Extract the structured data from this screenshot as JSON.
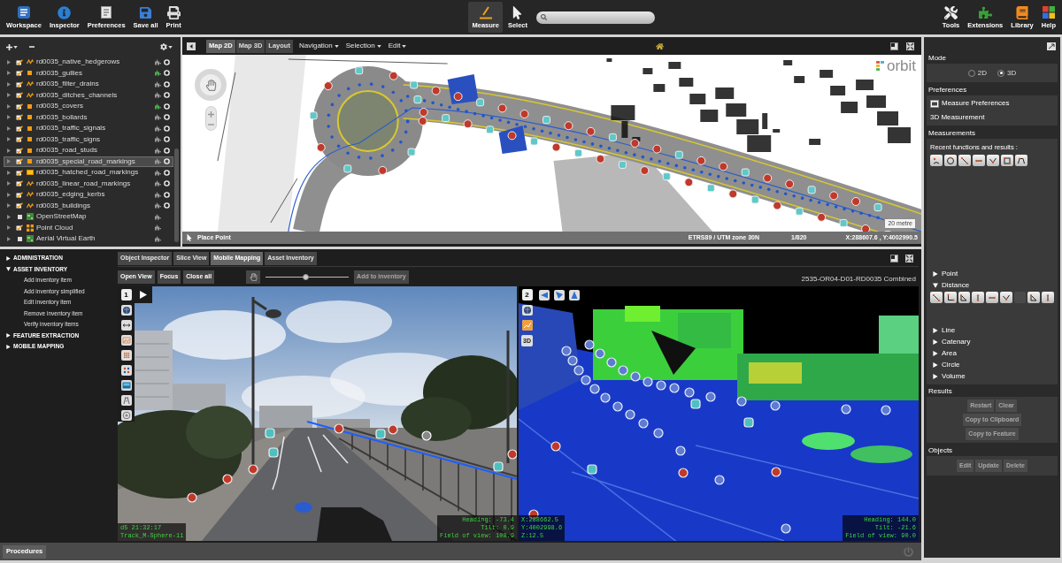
{
  "toolbar": {
    "left": [
      {
        "label": "Workspace"
      },
      {
        "label": "Inspector"
      },
      {
        "label": "Preferences"
      },
      {
        "label": "Save all"
      },
      {
        "label": "Print"
      }
    ],
    "center": [
      {
        "label": "Measure",
        "selected": true
      },
      {
        "label": "Select",
        "selected": false
      }
    ],
    "right": [
      {
        "label": "Tools"
      },
      {
        "label": "Extensions"
      },
      {
        "label": "Library"
      },
      {
        "label": "Help"
      }
    ]
  },
  "layers": {
    "items": [
      {
        "name": "rd0035_native_hedgerows",
        "kind": "line",
        "checked": true,
        "selected": false,
        "extension_active": false,
        "ring": true
      },
      {
        "name": "rd0035_gullies",
        "kind": "point",
        "checked": true,
        "selected": false,
        "extension_active": true,
        "ring": true
      },
      {
        "name": "rd0035_filter_drains",
        "kind": "line",
        "checked": true,
        "selected": false,
        "extension_active": false,
        "ring": true
      },
      {
        "name": "rd0035_ditches_channels",
        "kind": "line",
        "checked": true,
        "selected": false,
        "extension_active": false,
        "ring": true
      },
      {
        "name": "rd0035_covers",
        "kind": "point",
        "checked": true,
        "selected": false,
        "extension_active": true,
        "ring": true
      },
      {
        "name": "rd0035_bollards",
        "kind": "point",
        "checked": true,
        "selected": false,
        "extension_active": false,
        "ring": true
      },
      {
        "name": "rd0035_traffic_signals",
        "kind": "point",
        "checked": true,
        "selected": false,
        "extension_active": false,
        "ring": true
      },
      {
        "name": "rd0035_traffic_signs",
        "kind": "point",
        "checked": true,
        "selected": false,
        "extension_active": false,
        "ring": true
      },
      {
        "name": "rd0035_road_studs",
        "kind": "point",
        "checked": true,
        "selected": false,
        "extension_active": false,
        "ring": true
      },
      {
        "name": "rd0035_special_road_markings",
        "kind": "point",
        "checked": true,
        "selected": true,
        "extension_active": false,
        "ring": true
      },
      {
        "name": "rd0035_hatched_road_markings",
        "kind": "area",
        "checked": true,
        "selected": false,
        "extension_active": false,
        "ring": true
      },
      {
        "name": "rd0035_linear_road_markings",
        "kind": "line",
        "checked": true,
        "selected": false,
        "extension_active": false,
        "ring": true
      },
      {
        "name": "rd0035_edging_kerbs",
        "kind": "line",
        "checked": true,
        "selected": false,
        "extension_active": false,
        "ring": true
      },
      {
        "name": "rd0035_buildings",
        "kind": "line",
        "checked": true,
        "selected": false,
        "extension_active": false,
        "ring": true
      },
      {
        "name": "OpenStreetMap",
        "kind": "map",
        "checked": false,
        "selected": false,
        "extension_active": false,
        "ring": false
      },
      {
        "name": "Point Cloud",
        "kind": "cloud",
        "checked": true,
        "selected": false,
        "extension_active": false,
        "ring": false
      },
      {
        "name": "Aerial Virtual Earth",
        "kind": "map",
        "checked": false,
        "selected": false,
        "extension_active": false,
        "ring": false
      }
    ]
  },
  "map": {
    "tabs": [
      {
        "label": "Map 2D",
        "selected": true
      },
      {
        "label": "Map 3D",
        "selected": false
      },
      {
        "label": "Layout",
        "selected": false
      }
    ],
    "menus": [
      {
        "label": "Navigation"
      },
      {
        "label": "Selection"
      },
      {
        "label": "Edit"
      }
    ],
    "logo": "orbit",
    "scale": "20 metre",
    "status_bar": {
      "tool": "Place Point",
      "crs": "ETRS89 / UTM zone 30N",
      "ratio": "1/820",
      "coordinates": "X:288607.6 , Y:4002990.5"
    }
  },
  "procedures": {
    "sections": [
      {
        "label": "ADMINISTRATION",
        "expanded": false
      },
      {
        "label": "ASSET INVENTORY",
        "expanded": true,
        "children": [
          {
            "label": "Add inventory item"
          },
          {
            "label": "Add inventory simplified"
          },
          {
            "label": "Edit inventory item"
          },
          {
            "label": "Remove inventory item"
          },
          {
            "label": "Verify inventory items"
          }
        ]
      },
      {
        "label": "FEATURE EXTRACTION",
        "expanded": false
      },
      {
        "label": "MOBILE MAPPING",
        "expanded": false
      }
    ],
    "footer_tab": "Procedures"
  },
  "viewer": {
    "tabs": [
      {
        "label": "Object Inspector",
        "selected": false
      },
      {
        "label": "Slice View",
        "selected": false
      },
      {
        "label": "Mobile Mapping",
        "selected": true
      },
      {
        "label": "Asset Inventory",
        "selected": false
      }
    ],
    "buttons": [
      {
        "label": "Open View"
      },
      {
        "label": "Focus"
      },
      {
        "label": "Close all"
      }
    ],
    "slider": {
      "level": 0.48
    },
    "add_button": {
      "label": "Add to inventory",
      "disabled": true
    },
    "title": "2535-OR04-D01-RD0035 Combined",
    "views": [
      {
        "kind": "photo",
        "number": "1",
        "info_left": [
          "d5 21:32:17",
          "Track_M-Sphere-11"
        ],
        "info_right": [
          "Heading: -73.4",
          "Tilt: 0.9",
          "Field of view: 108.9"
        ]
      },
      {
        "kind": "point_cloud",
        "number": "2",
        "mode_label": "3D",
        "info_left": [
          "X:288662.5",
          "Y:4002998.6",
          "Z:12.5"
        ],
        "info_right": [
          "Heading: 144.0",
          "Tilt: -21.6",
          "Field of view: 90.0"
        ]
      }
    ]
  },
  "measure_panel": {
    "mode": {
      "title": "Mode",
      "options": [
        {
          "label": "2D",
          "selected": false
        },
        {
          "label": "3D",
          "selected": true
        }
      ]
    },
    "preferences": {
      "title": "Preferences",
      "items": [
        {
          "label": "Measure Preferences",
          "kind": "command"
        },
        {
          "label": "3D Measurement",
          "kind": "label"
        }
      ]
    },
    "measurements": {
      "title": "Measurements",
      "recent_label": "Recent functions and results :",
      "groups": [
        {
          "label": "Point",
          "expanded": false
        },
        {
          "label": "Distance",
          "expanded": true
        },
        {
          "label": "Line",
          "expanded": false
        },
        {
          "label": "Catenary",
          "expanded": false
        },
        {
          "label": "Area",
          "expanded": false
        },
        {
          "label": "Circle",
          "expanded": false
        },
        {
          "label": "Volume",
          "expanded": false
        }
      ]
    },
    "results": {
      "title": "Results",
      "buttons": [
        {
          "label": "Restart",
          "disabled": true
        },
        {
          "label": "Clear",
          "disabled": true
        },
        {
          "label": "Copy to Clipboard",
          "disabled": true
        },
        {
          "label": "Copy to Feature",
          "disabled": true
        }
      ]
    },
    "objects": {
      "title": "Objects",
      "buttons": [
        {
          "label": "Edit",
          "disabled": true
        },
        {
          "label": "Update",
          "disabled": true
        },
        {
          "label": "Delete",
          "disabled": true
        }
      ]
    }
  }
}
